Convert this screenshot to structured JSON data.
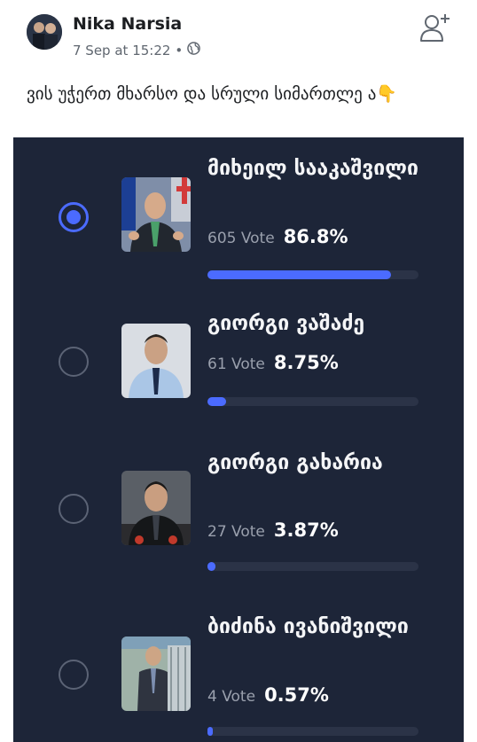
{
  "post": {
    "author": "Nika Narsia",
    "timestamp": "7 Sep at 15:22",
    "separator": "•",
    "audience_icon": "globe-icon",
    "text": "ვის უჭერთ მხარსო და სრული სიმართლე ა👇",
    "add_friend_icon": "add-friend-icon"
  },
  "colors": {
    "poll_background": "#1d2538",
    "accent": "#4b6bff",
    "track": "#2b3347"
  },
  "poll": {
    "options": [
      {
        "name": "მიხეილ სააკაშვილი",
        "votes": "605 Vote",
        "percent": "86.8%",
        "fraction": 0.868,
        "selected": true
      },
      {
        "name": "გიორგი ვაშაძე",
        "votes": "61 Vote",
        "percent": "8.75%",
        "fraction": 0.0875,
        "selected": false
      },
      {
        "name": "გიორგი გახარია",
        "votes": "27 Vote",
        "percent": "3.87%",
        "fraction": 0.0387,
        "selected": false
      },
      {
        "name": "ბიძინა ივანიშვილი",
        "votes": "4 Vote",
        "percent": "0.57%",
        "fraction": 0.0057,
        "selected": false
      }
    ]
  }
}
